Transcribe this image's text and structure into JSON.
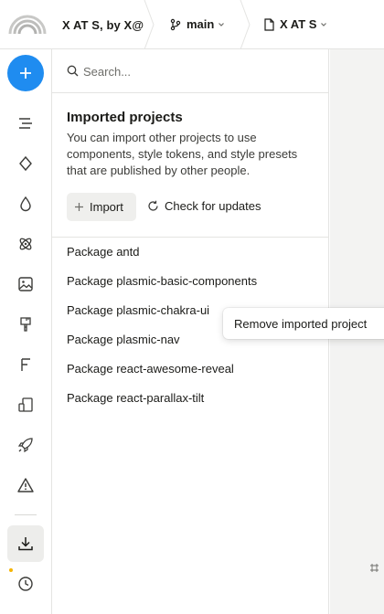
{
  "header": {
    "project_title": "X AT S, by X@",
    "branch": "main",
    "page": "X AT S"
  },
  "search": {
    "placeholder": "Search..."
  },
  "imported": {
    "title": "Imported projects",
    "description": "You can import other projects to use components, style tokens, and style presets that are published by other people.",
    "import_label": "Import",
    "check_label": "Check for updates",
    "packages": [
      "Package antd",
      "Package plasmic-basic-components",
      "Package plasmic-chakra-ui",
      "Package plasmic-nav",
      "Package react-awesome-reveal",
      "Package react-parallax-tilt"
    ]
  },
  "context_menu": {
    "remove_label": "Remove imported project"
  },
  "colors": {
    "accent": "#1f8cf0",
    "notification_dot": "#f5b400"
  },
  "rail_icons": [
    "add-icon",
    "outline-icon",
    "components-icon",
    "tokens-icon",
    "assets-icon",
    "images-icon",
    "mixins-icon",
    "fonts-icon",
    "responsiveness-icon",
    "publish-icon",
    "warnings-icon",
    "imports-icon",
    "history-icon"
  ]
}
